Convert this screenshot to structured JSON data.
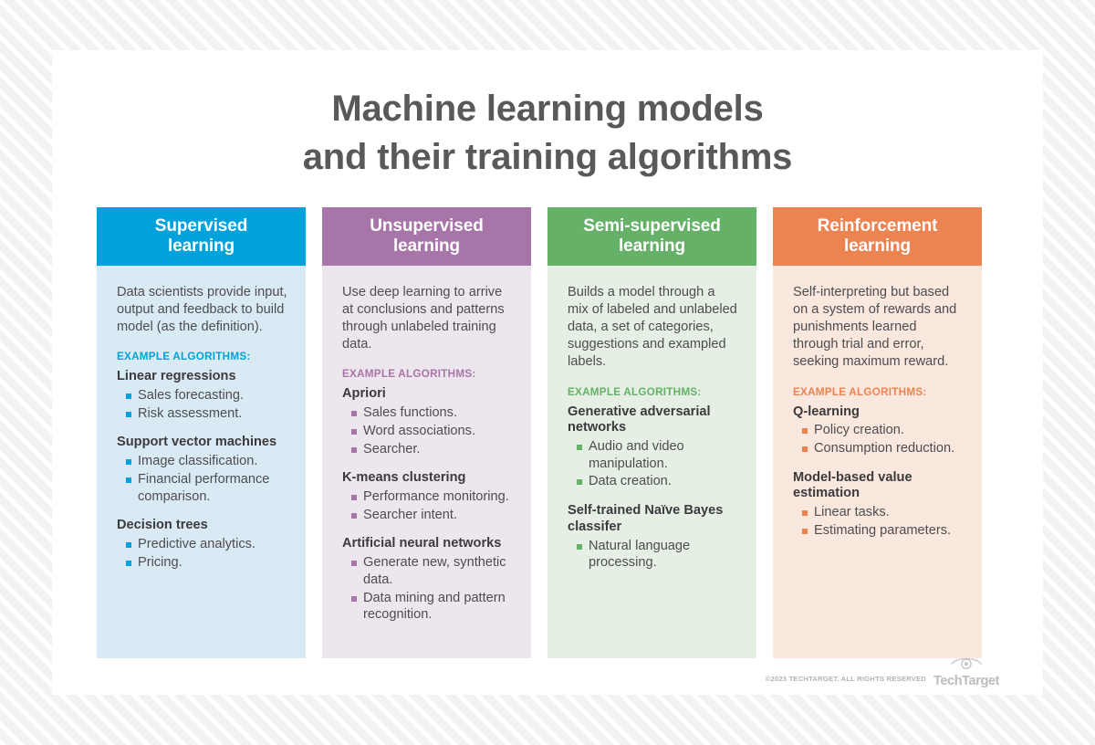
{
  "title": {
    "line1": "Machine learning models",
    "line2": "and their training algorithms"
  },
  "colors": {
    "supervised": "#00a2db",
    "unsupervised": "#a775a7",
    "semi_supervised": "#65b168",
    "reinforcement": "#ed8350",
    "title_text": "#58595b",
    "body_text": "#4d4d4f"
  },
  "columns": [
    {
      "header_line1": "Supervised",
      "header_line2": "learning",
      "intro": "Data scientists provide input, output and feedback to build model (as the definition).",
      "examples_label": "EXAMPLE ALGORITHMS:",
      "algorithms": [
        {
          "name": "Linear regressions",
          "items": [
            "Sales forecasting.",
            "Risk assessment."
          ]
        },
        {
          "name": "Support vector machines",
          "items": [
            "Image classification.",
            "Financial performance comparison."
          ]
        },
        {
          "name": "Decision trees",
          "items": [
            "Predictive analytics.",
            "Pricing."
          ]
        }
      ]
    },
    {
      "header_line1": "Unsupervised",
      "header_line2": "learning",
      "intro": "Use deep learning to arrive at conclusions and patterns through unlabeled training data.",
      "examples_label": "EXAMPLE ALGORITHMS:",
      "algorithms": [
        {
          "name": "Apriori",
          "items": [
            "Sales functions.",
            "Word associations.",
            "Searcher."
          ]
        },
        {
          "name": "K-means clustering",
          "items": [
            "Performance monitoring.",
            "Searcher intent."
          ]
        },
        {
          "name": "Artificial neural networks",
          "items": [
            "Generate new, synthetic data.",
            "Data mining and pattern recognition."
          ]
        }
      ]
    },
    {
      "header_line1": "Semi-supervised",
      "header_line2": "learning",
      "intro": "Builds a model through a mix of labeled and unlabeled data, a set of categories, suggestions and exampled labels.",
      "examples_label": "EXAMPLE ALGORITHMS:",
      "algorithms": [
        {
          "name": "Generative adversarial networks",
          "items": [
            "Audio and video manipulation.",
            "Data creation."
          ]
        },
        {
          "name": "Self-trained Naïve Bayes classifer",
          "items": [
            "Natural language processing."
          ]
        }
      ]
    },
    {
      "header_line1": "Reinforcement",
      "header_line2": "learning",
      "intro": "Self-interpreting but based on a system of rewards and punishments learned through trial and error, seeking maximum reward.",
      "examples_label": "EXAMPLE ALGORITHMS:",
      "algorithms": [
        {
          "name": "Q-learning",
          "items": [
            "Policy creation.",
            "Consumption reduction."
          ]
        },
        {
          "name": "Model-based value estimation",
          "items": [
            "Linear tasks.",
            "Estimating parameters."
          ]
        }
      ]
    }
  ],
  "footer": {
    "copyright": "©2023 TECHTARGET. ALL RIGHTS RESERVED",
    "brand": "TechTarget"
  }
}
